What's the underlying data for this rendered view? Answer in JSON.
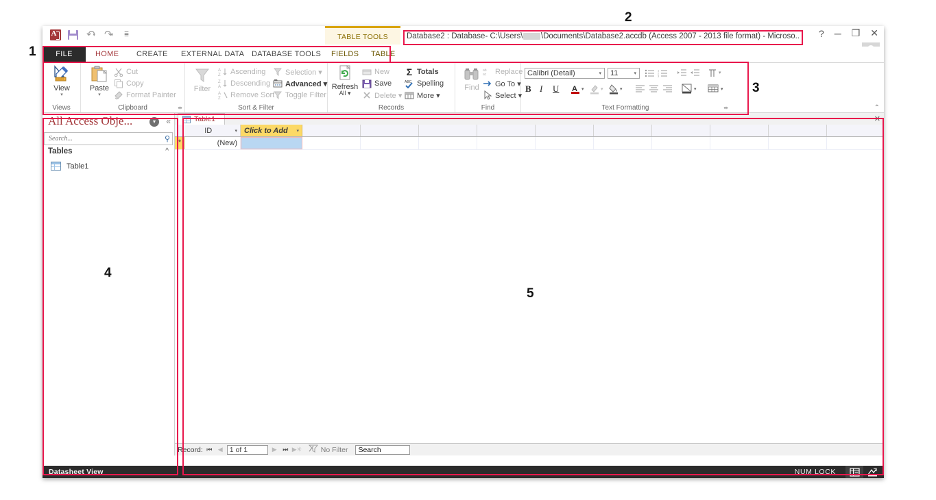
{
  "window": {
    "title_prefix": "Database2 : Database- C:\\Users\\",
    "title_suffix": "\\Documents\\Database2.accdb (Access 2007 - 2013 file format) - Microso..",
    "help_glyph": "?",
    "minimize_glyph": "─",
    "restore_glyph": "❐",
    "close_glyph": "✕",
    "account_caret": "▾"
  },
  "quick_access": {
    "items": [
      {
        "name": "access-logo-icon",
        "label": "A"
      },
      {
        "name": "save-icon",
        "label": "Save"
      },
      {
        "name": "undo-icon",
        "label": "↶"
      },
      {
        "name": "redo-icon",
        "label": "↷"
      },
      {
        "name": "customize-qat-icon",
        "label": "≡"
      }
    ]
  },
  "contextual_group": {
    "label": "TABLE TOOLS",
    "accent": "#d9a400"
  },
  "tabs": [
    {
      "label": "FILE",
      "state": "file"
    },
    {
      "label": "HOME",
      "state": "active"
    },
    {
      "label": "CREATE",
      "state": "normal"
    },
    {
      "label": "EXTERNAL DATA",
      "state": "normal"
    },
    {
      "label": "DATABASE TOOLS",
      "state": "normal"
    },
    {
      "label": "FIELDS",
      "state": "contextual"
    },
    {
      "label": "TABLE",
      "state": "contextual"
    }
  ],
  "ribbon": {
    "collapse_glyph": "⌃",
    "groups": [
      {
        "name": "views",
        "title": "Views",
        "big": [
          {
            "label": "View",
            "icon": "view-icon",
            "caret": "▾"
          }
        ],
        "small": []
      },
      {
        "name": "clipboard",
        "title": "Clipboard",
        "launcher": "⬌",
        "big": [
          {
            "label": "Paste",
            "icon": "paste-icon",
            "caret": "▾"
          }
        ],
        "small": [
          {
            "label": "Cut",
            "icon": "scissors-icon",
            "dim": true
          },
          {
            "label": "Copy",
            "icon": "copy-icon",
            "dim": true
          },
          {
            "label": "Format Painter",
            "icon": "format-painter-icon",
            "dim": true
          }
        ]
      },
      {
        "name": "sort-filter",
        "title": "Sort & Filter",
        "big": [
          {
            "label": "Filter",
            "icon": "funnel-icon",
            "dim": true
          }
        ],
        "small": [
          {
            "label": "Ascending",
            "icon": "sort-ascending-icon",
            "dim": true
          },
          {
            "label": "Descending",
            "icon": "sort-descending-icon",
            "dim": true
          },
          {
            "label": "Remove Sort",
            "icon": "remove-sort-icon",
            "dim": true
          },
          {
            "label": "Selection ▾",
            "icon": "selection-icon",
            "dim": true
          },
          {
            "label": "Advanced ▾",
            "icon": "advanced-icon",
            "dim": false
          },
          {
            "label": "Toggle Filter",
            "icon": "toggle-filter-icon",
            "dim": true
          }
        ]
      },
      {
        "name": "records",
        "title": "Records",
        "big": [
          {
            "label": "Refresh",
            "sublabel": "All ▾",
            "icon": "refresh-all-icon"
          }
        ],
        "small": [
          {
            "label": "New",
            "icon": "new-record-icon",
            "dim": true
          },
          {
            "label": "Save",
            "icon": "save-record-icon",
            "dim": false
          },
          {
            "label": "Delete ▾",
            "icon": "delete-record-icon",
            "dim": true
          },
          {
            "label": "Totals",
            "icon": "totals-sigma-icon",
            "dim": false
          },
          {
            "label": "Spelling",
            "icon": "spelling-icon",
            "dim": false
          },
          {
            "label": "More ▾",
            "icon": "more-icon",
            "dim": false
          }
        ]
      },
      {
        "name": "find",
        "title": "Find",
        "big": [
          {
            "label": "Find",
            "icon": "binoculars-icon",
            "dim": true
          }
        ],
        "small": [
          {
            "label": "Replace",
            "icon": "replace-icon",
            "dim": true
          },
          {
            "label": "Go To ▾",
            "icon": "goto-arrow-icon",
            "dim": false
          },
          {
            "label": "Select ▾",
            "icon": "select-cursor-icon",
            "dim": false
          }
        ]
      },
      {
        "name": "text-formatting",
        "title": "Text Formatting",
        "launcher": "⬌",
        "font_name": "Calibri (Detail)",
        "font_size": "11",
        "buttons": [
          "B",
          "I",
          "U"
        ],
        "small": []
      }
    ]
  },
  "nav_pane": {
    "title": "All Access Obje...",
    "dropdown_glyph": "▾",
    "collapse_glyph": "«",
    "search_placeholder": "Search...",
    "search_value": "",
    "search_icon": "search-icon",
    "group": {
      "label": "Tables",
      "chevron": "»"
    },
    "items": [
      {
        "label": "Table1",
        "icon": "table-icon"
      }
    ]
  },
  "datasheet": {
    "doc_tab": {
      "label": "Table1",
      "icon": "table-icon"
    },
    "close_glyph": "✕",
    "columns": [
      {
        "label": "ID",
        "kind": "field"
      },
      {
        "label": "Click to Add",
        "kind": "add"
      }
    ],
    "column_dropdown": "▾",
    "rows": [
      {
        "selector": "*",
        "cells": [
          "(New)",
          ""
        ]
      }
    ],
    "record_nav": {
      "label": "Record:",
      "first": "⏮",
      "prev": "◀",
      "position": "1 of 1",
      "next": "▶",
      "last": "⏭",
      "new": "▶✳",
      "filter_icon": "no-filter-icon",
      "filter_label": "No Filter",
      "search_value": "Search"
    }
  },
  "status_bar": {
    "view_label": "Datasheet View",
    "num_lock": "NUM LOCK",
    "buttons": [
      {
        "name": "datasheet-view-button",
        "selected": true
      },
      {
        "name": "design-view-button",
        "selected": false
      }
    ]
  },
  "annotations": [
    {
      "number": "1",
      "target": "ribbon-tabs"
    },
    {
      "number": "2",
      "target": "title-bar"
    },
    {
      "number": "3",
      "target": "ribbon"
    },
    {
      "number": "4",
      "target": "navigation-pane"
    },
    {
      "number": "5",
      "target": "datasheet"
    }
  ]
}
